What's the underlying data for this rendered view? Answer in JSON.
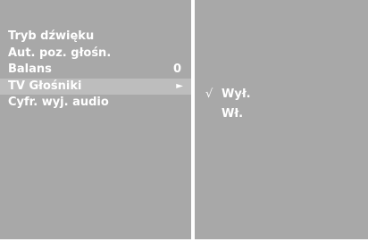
{
  "menu": {
    "items": [
      {
        "label": "Tryb dźwięku"
      },
      {
        "label": "Aut. poz. głośn."
      },
      {
        "label": "Balans",
        "value": "0"
      },
      {
        "label": "TV Głośniki",
        "arrow": "►"
      },
      {
        "label": "Cyfr. wyj. audio"
      }
    ]
  },
  "submenu": {
    "check_glyph": "√",
    "options": [
      {
        "label": "Wył."
      },
      {
        "label": "Wł."
      }
    ]
  },
  "colors": {
    "panel": "#a8a8a8",
    "selected_row": "#bdbdbd",
    "text": "#ffffff",
    "divider": "#ffffff"
  }
}
